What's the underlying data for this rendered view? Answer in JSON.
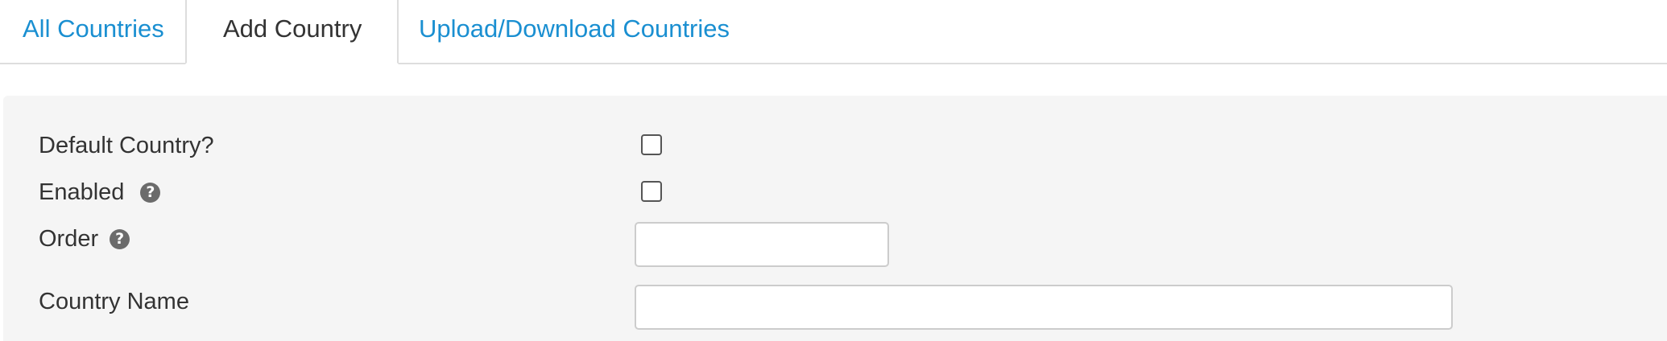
{
  "tabs": [
    {
      "label": "All Countries"
    },
    {
      "label": "Add Country"
    },
    {
      "label": "Upload/Download Countries"
    }
  ],
  "form": {
    "default_country": {
      "label": "Default Country?",
      "checked": false
    },
    "enabled": {
      "label": "Enabled",
      "checked": false
    },
    "order": {
      "label": "Order",
      "value": "",
      "placeholder": ""
    },
    "country_name": {
      "label": "Country Name",
      "value": "",
      "placeholder": ""
    },
    "help_glyph": "?"
  },
  "colors": {
    "link": "#1a8fd1",
    "panel_bg": "#f5f5f5",
    "text": "#333333",
    "help_icon": "#6b6b6b"
  }
}
